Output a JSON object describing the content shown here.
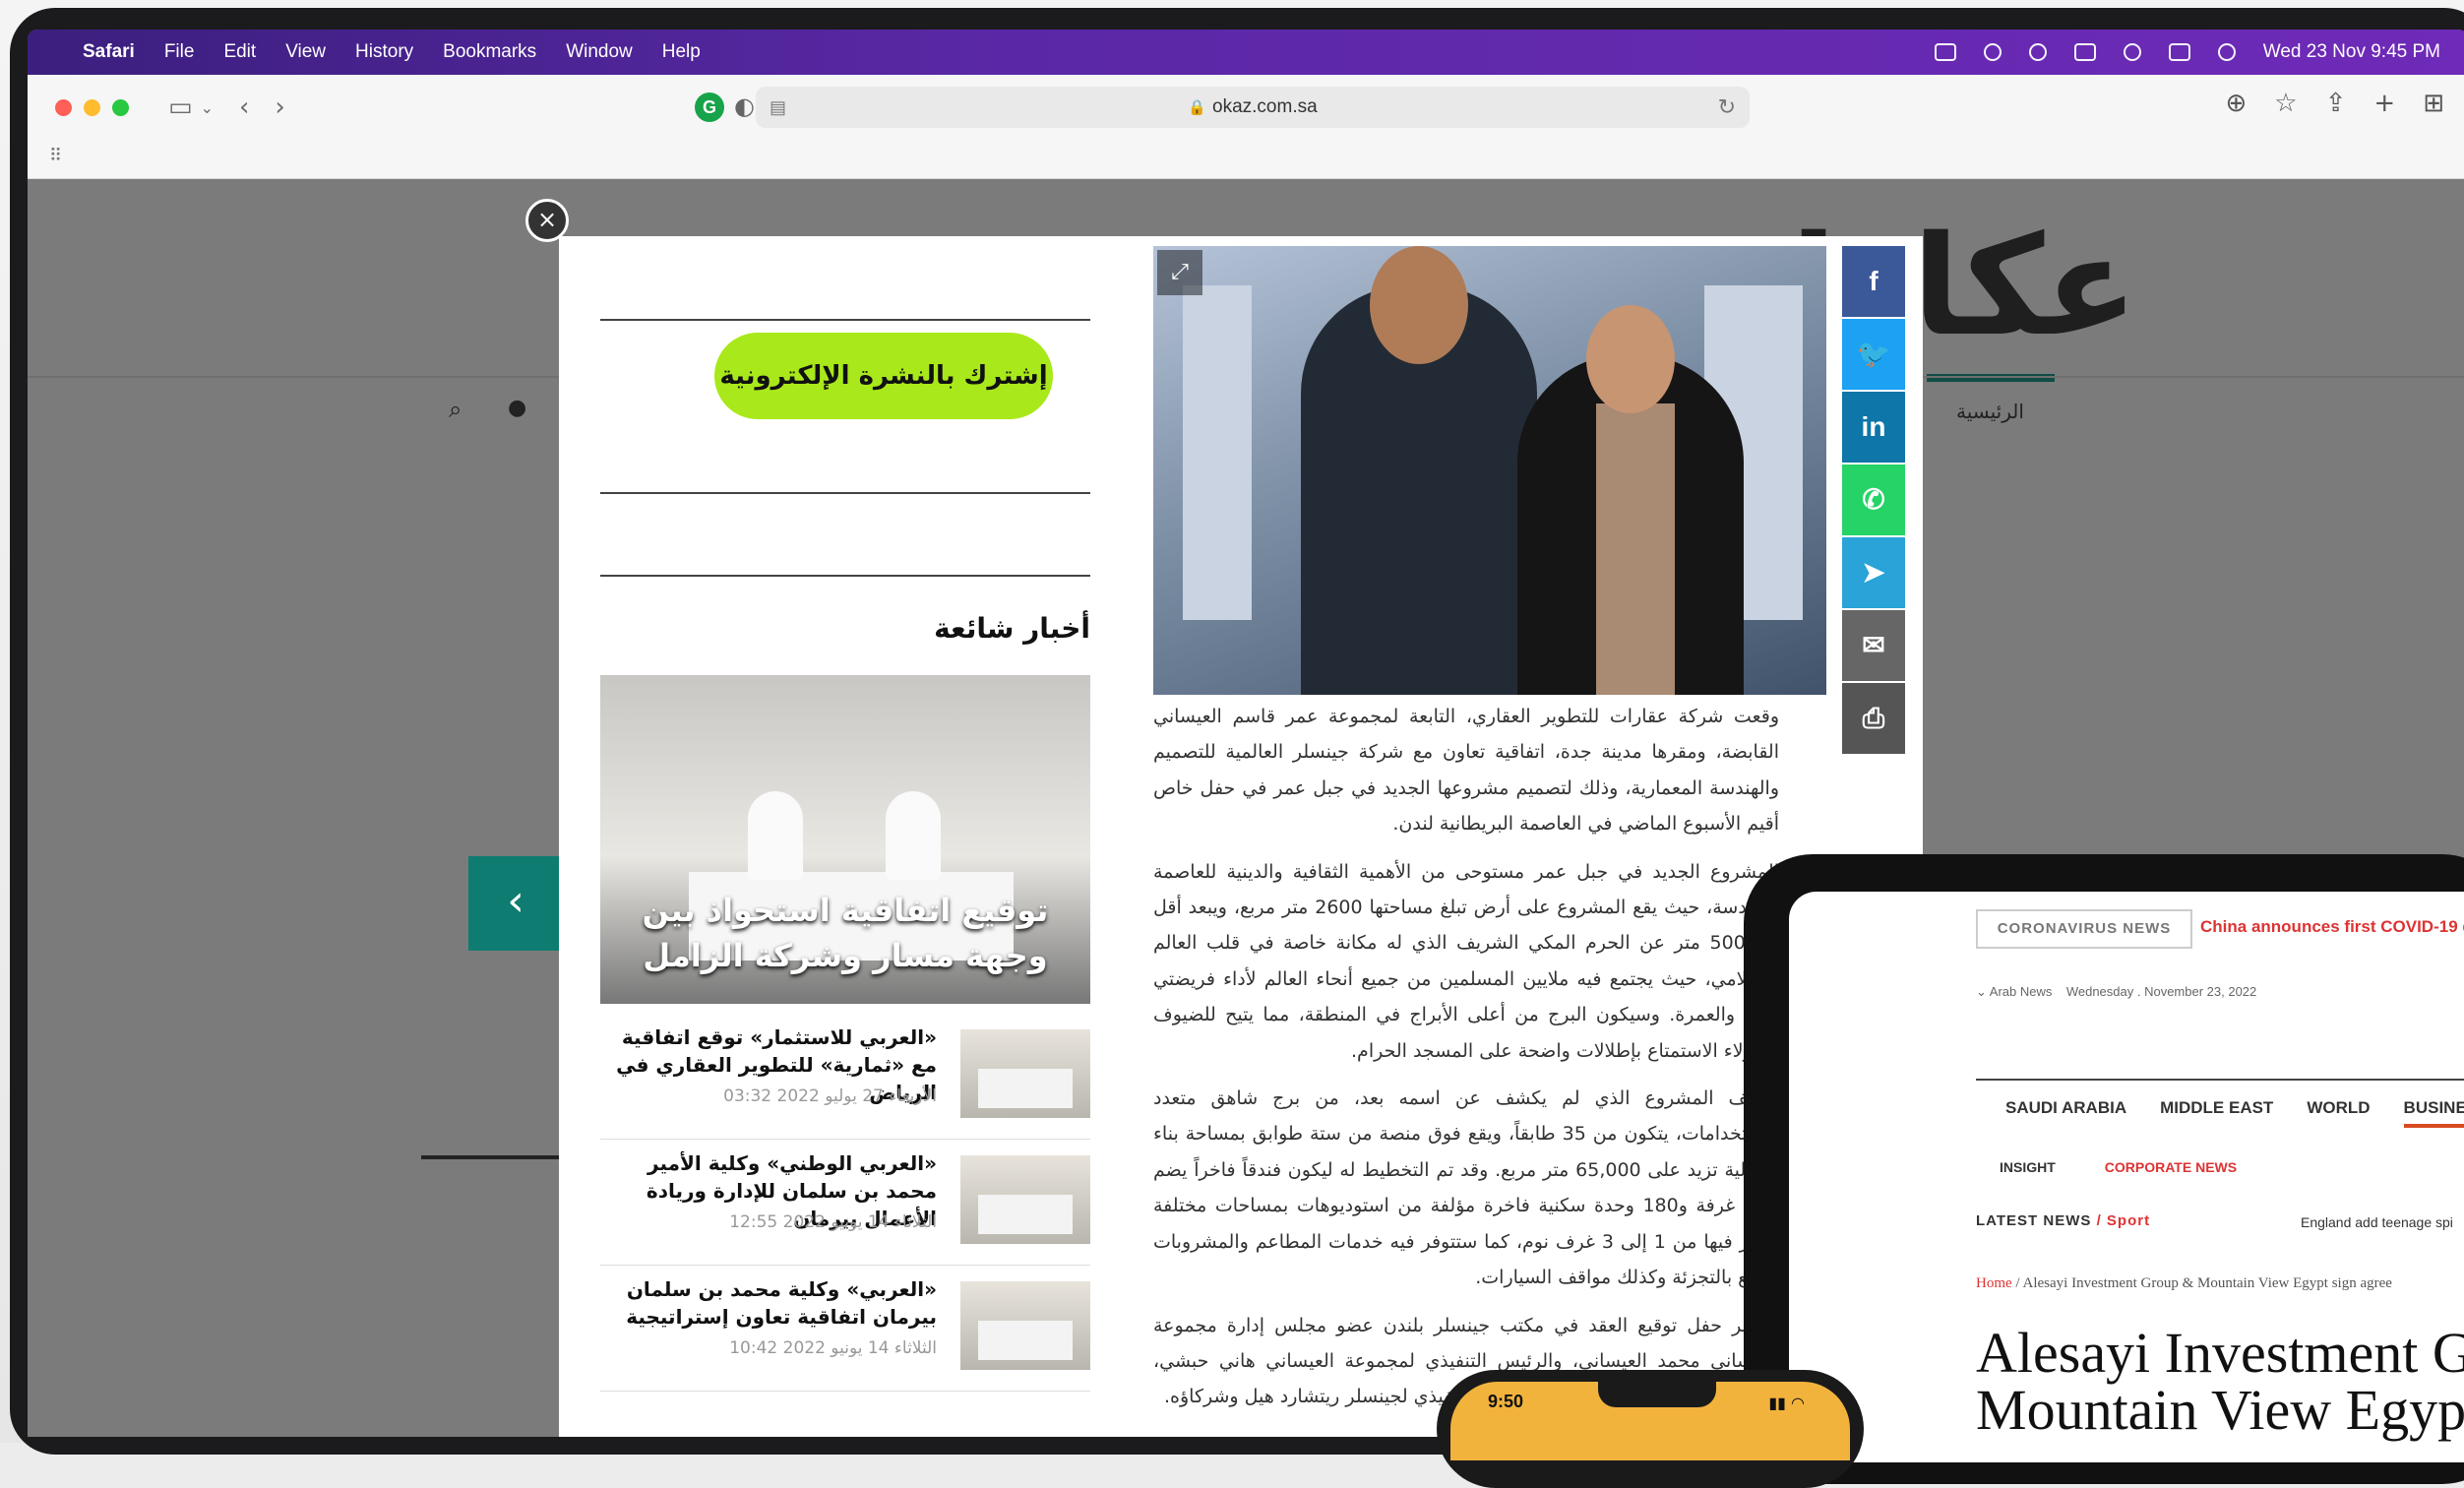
{
  "menubar": {
    "app": "Safari",
    "items": [
      "File",
      "Edit",
      "View",
      "History",
      "Bookmarks",
      "Window",
      "Help"
    ],
    "clock": "Wed 23 Nov  9:45 PM"
  },
  "toolbar": {
    "url": "okaz.com.sa",
    "extension_letter": "G"
  },
  "site": {
    "logo": "عكاظ",
    "nav_home": "الرئيسية"
  },
  "modal": {
    "subscribe_label": "إشترك بالنشرة الإلكترونية",
    "popular_title": "أخبار شائعة",
    "feature_caption": "توقيع اتفاقية استحواذ بين وجهة مسار وشركة الزامل",
    "news": [
      {
        "title": "«العربي للاستثمار» توقع اتفاقية مع «ثمارية» للتطوير العقاري في الرياض",
        "date": "الأربعاء 27 يوليو 2022 03:32"
      },
      {
        "title": "«العربي الوطني» وكلية الأمير محمد بن سلمان للإدارة وريادة الأعمال بيرمان",
        "date": "الثلاثاء 14 يونيو 2022 12:55"
      },
      {
        "title": "«العربي» وكلية محمد بن سلمان بيرمان اتفاقية تعاون إستراتيجية",
        "date": "الثلاثاء 14 يونيو 2022 10:42"
      }
    ],
    "share": [
      {
        "name": "facebook-icon",
        "glyph": "f",
        "color": "#3b5998"
      },
      {
        "name": "twitter-icon",
        "glyph": "🐦",
        "color": "#1da1f2"
      },
      {
        "name": "linkedin-icon",
        "glyph": "in",
        "color": "#0e76a8"
      },
      {
        "name": "whatsapp-icon",
        "glyph": "✆",
        "color": "#25d366"
      },
      {
        "name": "telegram-icon",
        "glyph": "➤",
        "color": "#2aa3d8"
      },
      {
        "name": "email-icon",
        "glyph": "✉",
        "color": "#666666"
      },
      {
        "name": "print-icon",
        "glyph": "⎙",
        "color": "#555555"
      }
    ],
    "article": [
      "وقعت شركة عقارات للتطوير العقاري، التابعة لمجموعة عمر قاسم العيساني القابضة، ومقرها مدينة جدة، اتفاقية تعاون مع شركة جينسلر العالمية للتصميم والهندسة المعمارية، وذلك لتصميم مشروعها الجديد في جبل عمر في حفل خاص أقيم الأسبوع الماضي في العاصمة البريطانية لندن.",
      "المشروع الجديد في جبل عمر مستوحى من الأهمية الثقافية والدينية للعاصمة المقدسة، حيث يقع المشروع على أرض تبلغ مساحتها 2600 متر مربع، ويبعد أقل من 500 متر عن الحرم المكي الشريف الذي له مكانة خاصة في قلب العالم الإسلامي، حيث يجتمع فيه ملايين المسلمين من جميع أنحاء العالم لأداء فريضتي الحج والعمرة. وسيكون البرج من أعلى الأبراج في المنطقة، مما يتيح للضيوف والنزلاء الاستمتاع بإطلالات واضحة على المسجد الحرام.",
      "ويتألف المشروع الذي لم يكشف عن اسمه بعد، من برج شاهق متعدد الاستخدامات، يتكون من 35 طابقاً، ويقع فوق منصة من ستة طوابق بمساحة بناء إجمالية تزيد على 65,000 متر مربع. وقد تم التخطيط له ليكون فندقاً فاخراً يضم 340 غرفة و180 وحدة سكنية فاخرة مؤلفة من استوديوهات بمساحات مختلفة تتوفر فيها من 1 إلى 3 غرف نوم، كما ستتوفر فيه خدمات المطاعم والمشروبات والبيع بالتجزئة وكذلك مواقف السيارات.",
      "وحضر حفل توقيع العقد في مكتب جينسلر بلندن عضو مجلس إدارة مجموعة العيساني محمد العيساني، والرئيس التنفيذي لمجموعة العيساني هاني حبشي، ونائب الرئيس حاتم العيساني، والرئيس التنفيذي لجينسلر ريتشارد هيل وشركاؤه."
    ]
  },
  "tablet": {
    "covid_label": "CORONAVIRUS NEWS",
    "covid_headline": "China announces first COVID-19 de",
    "source": "Arab News",
    "date": "Wednesday . November 23, 2022",
    "nav": [
      "SAUDI ARABIA",
      "MIDDLE EAST",
      "WORLD",
      "BUSINE"
    ],
    "sub_nav": [
      "INSIGHT",
      "CORPORATE NEWS"
    ],
    "latest_label": "LATEST NEWS",
    "latest_section": "Sport",
    "latest_text": "England add teenage spi",
    "crumb_home": "Home",
    "crumb_rest": "Alesayi Investment Group & Mountain View Egypt sign agree",
    "headline_1": "Alesayi Investment G",
    "headline_2": "Mountain View Egyp"
  },
  "phone": {
    "time": "9:50"
  }
}
